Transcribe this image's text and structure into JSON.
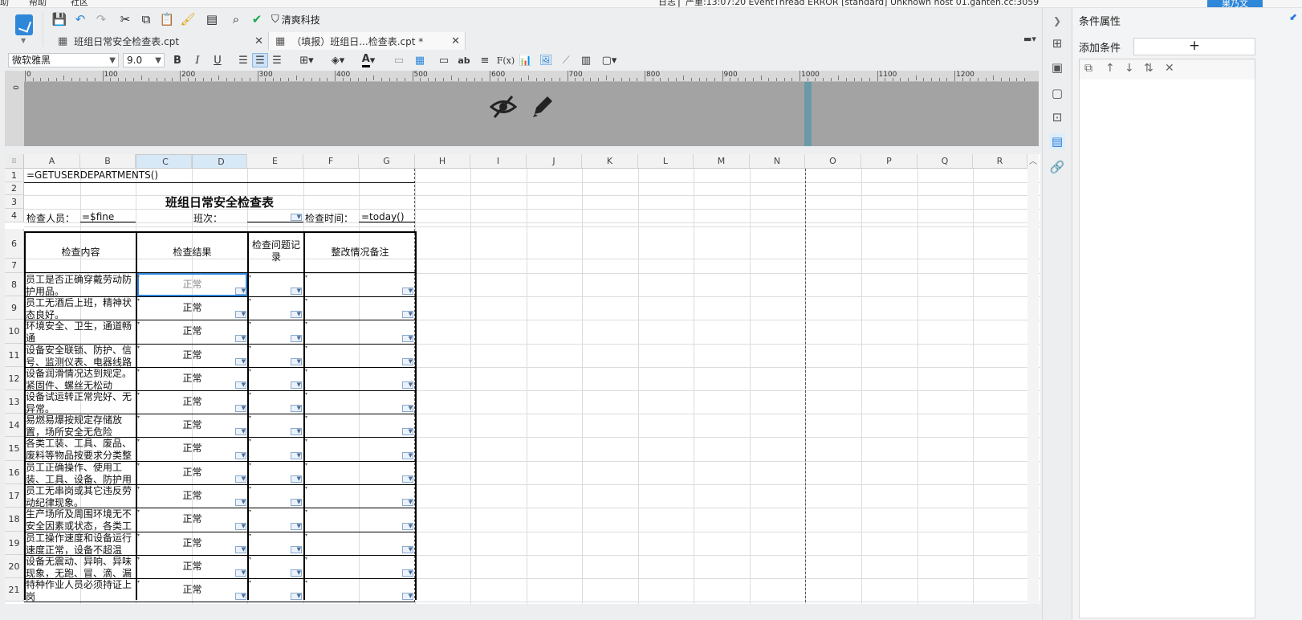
{
  "topbar": {
    "menu_items": [
      "助",
      "帮助",
      "社区"
    ],
    "status_text": "日志 ▏严重:13:07:20 EventThread ERROR [standard] Unknown host 01.ganten.cc:3059",
    "user_label": "果乃文"
  },
  "quick_toolbar": {
    "icons": [
      "save-icon",
      "undo-icon",
      "redo-icon",
      "cut-icon",
      "copy-icon",
      "paste-icon",
      "format-brush-icon",
      "preview-icon",
      "search-preview-icon",
      "check-icon"
    ],
    "plugin_label": "清爽科技"
  },
  "tabs": [
    {
      "label": "班组日常安全检查表.cpt",
      "active": false
    },
    {
      "label": "（填报）班组日...检查表.cpt *",
      "active": true
    }
  ],
  "format_bar": {
    "font": "微软雅黑",
    "size": "9.0",
    "bold": "B",
    "italic": "I",
    "underline": "U",
    "font_color_label": "A",
    "text_label": "ab",
    "formula_label": "F(x)"
  },
  "ruler": {
    "ticks": [
      "0",
      "100",
      "200",
      "300",
      "400",
      "500",
      "600",
      "700",
      "800",
      "900",
      "1000",
      "1100",
      "1200"
    ],
    "vertical_label": "0"
  },
  "sheet": {
    "columns": [
      "A",
      "B",
      "C",
      "D",
      "E",
      "F",
      "G",
      "H",
      "I",
      "J",
      "K",
      "L",
      "M",
      "N",
      "O",
      "P",
      "Q",
      "R"
    ],
    "selected_columns": [
      "C",
      "D"
    ],
    "rows": [
      "1",
      "2",
      "3",
      "4",
      "6",
      "7",
      "8",
      "9",
      "10",
      "11",
      "12",
      "13",
      "14",
      "15",
      "16",
      "17",
      "18",
      "19",
      "20",
      "21"
    ],
    "formula_cell": "=GETUSERDEPARTMENTS()",
    "title": "班组日常安全检查表",
    "row4": {
      "inspector_label": "检查人员：",
      "inspector_value": "=$fine_",
      "shift_label": "班次：",
      "time_label": "检查时间：",
      "time_value": "=today()"
    },
    "headers": {
      "content": "检查内容",
      "result": "检查结果",
      "problem": "检查问题记录",
      "remark": "整改情况备注"
    },
    "items": [
      {
        "text": "员工是否正确穿戴劳动防护用品。",
        "result": "正常"
      },
      {
        "text": "员工无酒后上班，精神状态良好。",
        "result": "正常"
      },
      {
        "text": "环境安全、卫生，通道畅通",
        "result": "正常"
      },
      {
        "text": "设备安全联锁、防护、信号、监测仪表、电器线路",
        "result": "正常"
      },
      {
        "text": "设备润滑情况达到规定。紧固件、螺丝无松动",
        "result": "正常"
      },
      {
        "text": "设备试运转正常完好、无异常。",
        "result": "正常"
      },
      {
        "text": "易燃易爆按规定存储放置，场所安全无危险",
        "result": "正常"
      },
      {
        "text": "各类工装、工具、废品、废料等物品按要求分类整",
        "result": "正常"
      },
      {
        "text": "员工正确操作、使用工装、工具、设备、防护用",
        "result": "正常"
      },
      {
        "text": "员工无串岗或其它违反劳动纪律现象。",
        "result": "正常"
      },
      {
        "text": "生产场所及周围环境无不安全因素或状态，各类工",
        "result": "正常"
      },
      {
        "text": "员工操作速度和设备运行速度正常，设备不超温",
        "result": "正常"
      },
      {
        "text": "设备无震动、异响、异味现象，无跑、冒、滴、漏",
        "result": "正常"
      },
      {
        "text": "特种作业人员必须持证上岗",
        "result": "正常"
      }
    ]
  },
  "right_panel": {
    "title": "条件属性",
    "add_condition": "添加条件",
    "add_symbol": "+",
    "tool_icons": [
      "copy-icon",
      "arrow-up-icon",
      "arrow-down-icon",
      "sort-icon",
      "delete-icon"
    ]
  }
}
